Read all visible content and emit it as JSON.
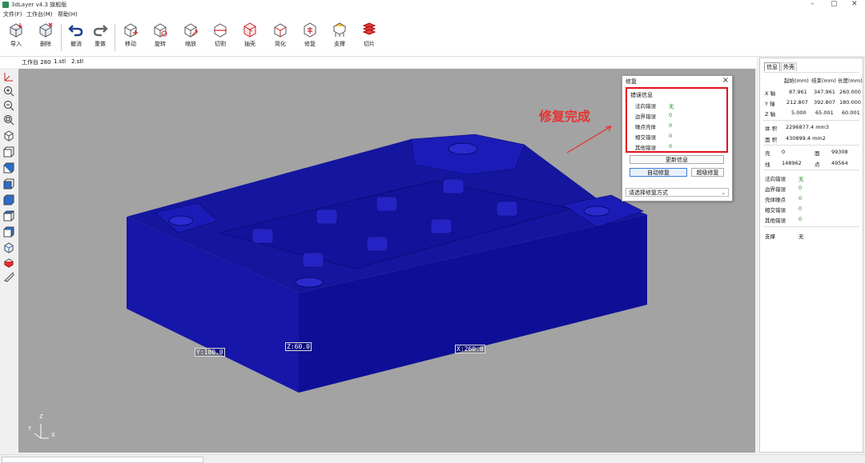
{
  "app": {
    "title": "3dLayer v4.3 旗舰版",
    "window_controls": [
      "–",
      "▢",
      "✕"
    ]
  },
  "menu": [
    "文件(F)",
    "工作台(M)",
    "帮助(H)"
  ],
  "toolbar": [
    {
      "label": "导入",
      "icon": "import-icon"
    },
    {
      "label": "删除",
      "icon": "delete-icon"
    },
    {
      "label": "撤消",
      "icon": "undo-icon"
    },
    {
      "label": "重做",
      "icon": "redo-icon"
    },
    {
      "label": "移动",
      "icon": "move-icon"
    },
    {
      "label": "旋转",
      "icon": "rotate-icon"
    },
    {
      "label": "缩放",
      "icon": "scale-icon"
    },
    {
      "label": "切割",
      "icon": "cut-icon"
    },
    {
      "label": "抽壳",
      "icon": "shell-icon"
    },
    {
      "label": "简化",
      "icon": "simplify-icon"
    },
    {
      "label": "修复",
      "icon": "repair-icon"
    },
    {
      "label": "支撑",
      "icon": "support-icon"
    },
    {
      "label": "切片",
      "icon": "slice-icon"
    }
  ],
  "workspace": {
    "label": "工作台 280",
    "files": [
      "1.stl",
      "2.stl"
    ]
  },
  "viewport": {
    "dims": {
      "y": "Y:180.0",
      "z": "Z:60.0",
      "x": "X:260.0"
    },
    "axes": {
      "x": "X",
      "y": "Y",
      "z": "Z"
    },
    "annotation": "修复完成",
    "model_color": "#15169e"
  },
  "repair_dialog": {
    "title": "修复",
    "close": "×",
    "group_title": "错误信息",
    "errors": [
      {
        "label": "法向错误",
        "value": "无"
      },
      {
        "label": "边界错误",
        "value": "0"
      },
      {
        "label": "噪点壳体",
        "value": "0"
      },
      {
        "label": "相交错误",
        "value": "0"
      },
      {
        "label": "其他错误",
        "value": "0"
      }
    ],
    "update_button": "更新信息",
    "auto_button": "自动修复",
    "super_button": "超级修复",
    "select_placeholder": "请选择修复方式",
    "highlight_color": "#e2121e"
  },
  "info_panel": {
    "tabs": [
      "信息",
      "外壳"
    ],
    "headers": [
      "起始(mm)",
      "结束(mm)",
      "长度(mm)"
    ],
    "axes": [
      {
        "axis": "X 轴",
        "start": "87.961",
        "end": "347.961",
        "len": "260.000"
      },
      {
        "axis": "Y 轴",
        "start": "212.807",
        "end": "392.807",
        "len": "180.000"
      },
      {
        "axis": "Z 轴",
        "start": "5.000",
        "end": "65.001",
        "len": "60.001"
      }
    ],
    "volume_label": "体 积",
    "volume_value": "2296877.4 mm3",
    "area_label": "面 积",
    "area_value": "430899.4 mm2",
    "shell_label": "壳",
    "shell_value": "0",
    "face_label": "面",
    "face_value": "99308",
    "line_label": "线",
    "line_value": "148962",
    "point_label": "点",
    "point_value": "49564",
    "errors": [
      {
        "label": "法向错误",
        "value": "无"
      },
      {
        "label": "边界错误",
        "value": "0"
      },
      {
        "label": "壳体噪点",
        "value": "0"
      },
      {
        "label": "相交错误",
        "value": "0"
      },
      {
        "label": "其他错误",
        "value": "0"
      }
    ],
    "support_label": "支撑",
    "support_value": "无"
  }
}
